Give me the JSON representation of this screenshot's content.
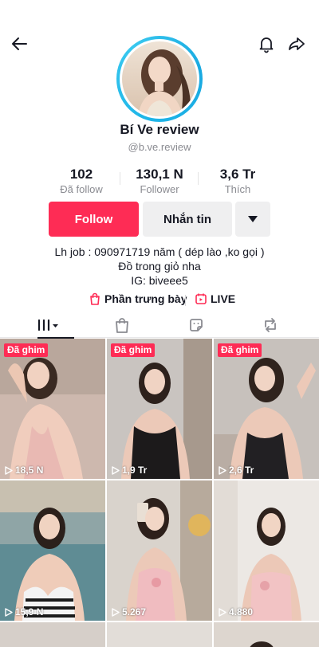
{
  "profile": {
    "name": "Bí Ve review",
    "handle": "@b.ve.review"
  },
  "stats": [
    {
      "value": "102",
      "label": "Đã follow"
    },
    {
      "value": "130,1 N",
      "label": "Follower"
    },
    {
      "value": "3,6 Tr",
      "label": "Thích"
    }
  ],
  "actions": {
    "follow_label": "Follow",
    "message_label": "Nhắn tin"
  },
  "bio": {
    "line1": "Lh job : 090971719 năm  ( dép lào ,ko gọi )",
    "line2": "Đồ trong giỏ nha",
    "line3": "IG: biveee5"
  },
  "links": {
    "showcase_label": "Phần trưng bày",
    "live_label": "LIVE"
  },
  "colors": {
    "accent": "#fe2c55",
    "avatar_ring": "#1fb6e8"
  },
  "videos": [
    {
      "pinned": "Đã ghim",
      "views": "18,5 N"
    },
    {
      "pinned": "Đã ghim",
      "views": "1,9 Tr"
    },
    {
      "pinned": "Đã ghim",
      "views": "2,6 Tr"
    },
    {
      "pinned": "",
      "views": "15,9 N"
    },
    {
      "pinned": "",
      "views": "5.267"
    },
    {
      "pinned": "",
      "views": "4.880"
    }
  ]
}
